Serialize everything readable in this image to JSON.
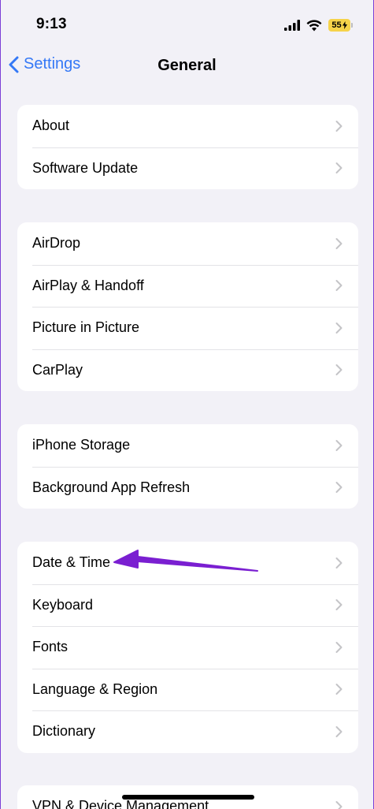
{
  "status_bar": {
    "time": "9:13",
    "battery_level": "55"
  },
  "nav": {
    "back_label": "Settings",
    "title": "General"
  },
  "groups": [
    [
      "About",
      "Software Update"
    ],
    [
      "AirDrop",
      "AirPlay & Handoff",
      "Picture in Picture",
      "CarPlay"
    ],
    [
      "iPhone Storage",
      "Background App Refresh"
    ],
    [
      "Date & Time",
      "Keyboard",
      "Fonts",
      "Language & Region",
      "Dictionary"
    ],
    [
      "VPN & Device Management"
    ]
  ],
  "colors": {
    "accent": "#3478f6",
    "annotation_arrow": "#7a1fd1",
    "battery": "#f6d34a"
  },
  "annotation": {
    "type": "arrow",
    "points_to": "Date & Time"
  }
}
